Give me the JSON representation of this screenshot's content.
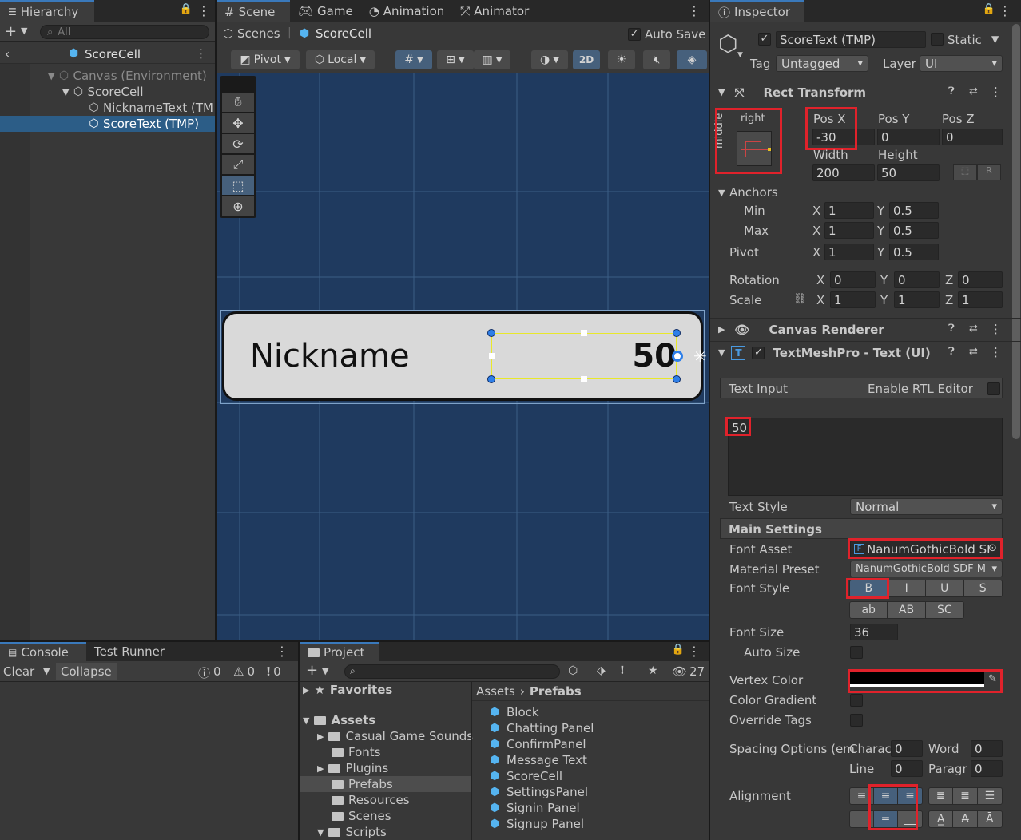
{
  "hierarchy": {
    "tab": "Hierarchy",
    "search_placeholder": "All",
    "scene_title": "ScoreCell",
    "items": [
      {
        "label": "Canvas (Environment)"
      },
      {
        "label": "ScoreCell"
      },
      {
        "label": "NicknameText (TM"
      },
      {
        "label": "ScoreText (TMP)"
      }
    ]
  },
  "scene": {
    "tabs": [
      "Scene",
      "Game",
      "Animation",
      "Animator"
    ],
    "breadcrumb_root": "Scenes",
    "breadcrumb_current": "ScoreCell",
    "auto_save": "Auto Save",
    "pivot": "Pivot",
    "local": "Local",
    "mode_2d": "2D",
    "cell_nickname": "Nickname",
    "cell_score": "50"
  },
  "inspector": {
    "tab": "Inspector",
    "object_name": "ScoreText (TMP)",
    "static_label": "Static",
    "tag_label": "Tag",
    "tag_value": "Untagged",
    "layer_label": "Layer",
    "layer_value": "UI",
    "rect_transform": {
      "title": "Rect Transform",
      "anchor_h": "right",
      "anchor_v": "middle",
      "posx_label": "Pos X",
      "posx": "-30",
      "posy_label": "Pos Y",
      "posy": "0",
      "posz_label": "Pos Z",
      "posz": "0",
      "width_label": "Width",
      "width": "200",
      "height_label": "Height",
      "height": "50",
      "anchors_label": "Anchors",
      "min_label": "Min",
      "min_x": "1",
      "min_y": "0.5",
      "max_label": "Max",
      "max_x": "1",
      "max_y": "0.5",
      "pivot_label": "Pivot",
      "pivot_x": "1",
      "pivot_y": "0.5",
      "rotation_label": "Rotation",
      "rot_x": "0",
      "rot_y": "0",
      "rot_z": "0",
      "scale_label": "Scale",
      "scale_x": "1",
      "scale_y": "1",
      "scale_z": "1",
      "x": "X",
      "y": "Y",
      "z": "Z"
    },
    "canvas_renderer": "Canvas Renderer",
    "tmp": {
      "title": "TextMeshPro - Text (UI)",
      "text_input_label": "Text Input",
      "rtl_label": "Enable RTL Editor",
      "text_value": "50",
      "text_style_label": "Text Style",
      "text_style_value": "Normal",
      "main_settings": "Main Settings",
      "font_asset_label": "Font Asset",
      "font_asset_value": "NanumGothicBold SI",
      "material_label": "Material Preset",
      "material_value": "NanumGothicBold SDF M",
      "font_style_label": "Font Style",
      "style_buttons": [
        "B",
        "I",
        "U",
        "S"
      ],
      "case_buttons": [
        "ab",
        "AB",
        "SC"
      ],
      "font_size_label": "Font Size",
      "font_size_value": "36",
      "auto_size_label": "Auto Size",
      "vertex_color_label": "Vertex Color",
      "vertex_color": "#000000",
      "color_gradient_label": "Color Gradient",
      "override_tags_label": "Override Tags",
      "spacing_label": "Spacing Options (em",
      "charac_label": "Charac",
      "charac_value": "0",
      "word_label": "Word",
      "word_value": "0",
      "line_label": "Line",
      "line_value": "0",
      "paragr_label": "Paragr",
      "paragr_value": "0",
      "alignment_label": "Alignment"
    }
  },
  "console": {
    "tabs": [
      "Console",
      "Test Runner"
    ],
    "clear": "Clear",
    "collapse": "Collapse",
    "counts": [
      "0",
      "0",
      "0"
    ]
  },
  "project": {
    "tab": "Project",
    "count": "27",
    "favorites": "Favorites",
    "assets": "Assets",
    "folders": [
      "Casual Game Sounds",
      "Fonts",
      "Plugins",
      "Prefabs",
      "Resources",
      "Scenes",
      "Scripts"
    ],
    "breadcrumb_assets": "Assets",
    "breadcrumb_prefabs": "Prefabs",
    "prefabs": [
      "Block",
      "Chatting Panel",
      "ConfirmPanel",
      "Message Text",
      "ScoreCell",
      "SettingsPanel",
      "Signin Panel",
      "Signup Panel"
    ]
  },
  "colors": {
    "accent": "#3a79bb",
    "selection": "#2c5d87",
    "highlight": "#e0222b",
    "scene_bg": "#1f3a5f"
  }
}
